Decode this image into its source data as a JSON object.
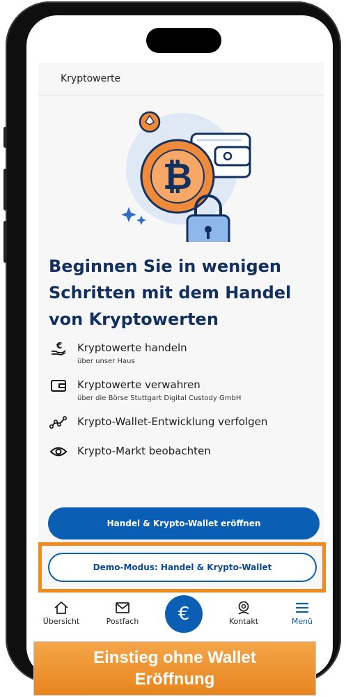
{
  "header": {
    "title": "Kryptowerte"
  },
  "headline": "Beginnen Sie in wenigen Schritten mit dem Handel von Kryptowerten",
  "features": [
    {
      "icon": "euro-hand-icon",
      "title": "Kryptowerte handeln",
      "subtitle": "über unser Haus"
    },
    {
      "icon": "wallet-icon",
      "title": "Kryptowerte verwahren",
      "subtitle": "über die Börse Stuttgart Digital Custody GmbH"
    },
    {
      "icon": "chart-line-icon",
      "title": "Krypto-Wallet-Entwicklung verfolgen",
      "subtitle": ""
    },
    {
      "icon": "eye-icon",
      "title": "Krypto-Markt beobachten",
      "subtitle": ""
    }
  ],
  "buttons": {
    "primary": "Handel & Krypto-Wallet eröffnen",
    "demo": "Demo-Modus: Handel & Krypto-Wallet"
  },
  "nav": {
    "overview": "Übersicht",
    "inbox": "Postfach",
    "center_symbol": "€",
    "contact": "Kontakt",
    "menu": "Menü"
  },
  "banner": {
    "line1": "Einstieg ohne Wallet",
    "line2": "Eröffnung"
  },
  "colors": {
    "brand_blue": "#0a5fb4",
    "headline_navy": "#12305f",
    "highlight_orange": "#f08a1c"
  }
}
